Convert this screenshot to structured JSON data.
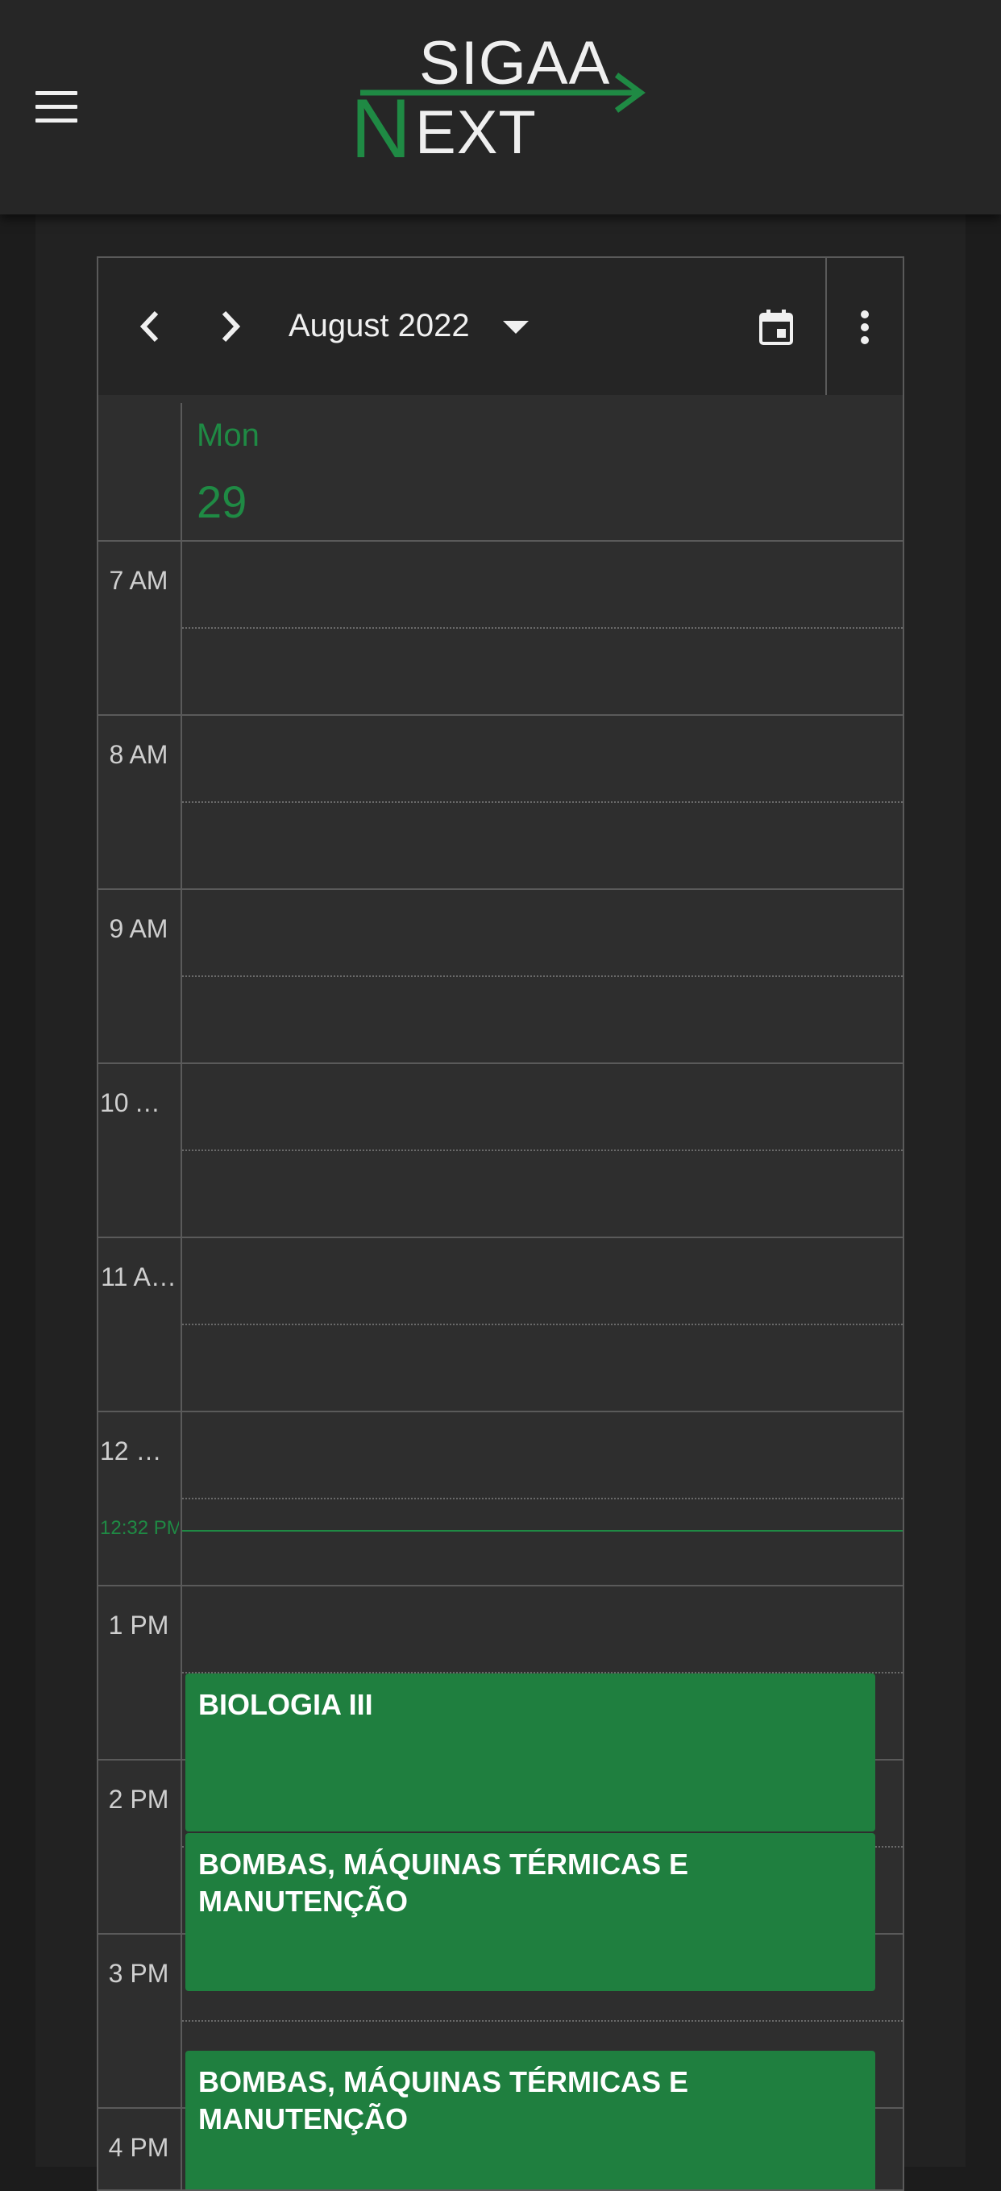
{
  "app": {
    "logo_top": "SIGAA",
    "logo_n": "N",
    "logo_bottom": "EXT",
    "accent_color": "#1f8a44"
  },
  "toolbar": {
    "prev_icon": "chevron-left-icon",
    "next_icon": "chevron-right-icon",
    "month": "August 2022",
    "today_icon": "calendar-today-icon",
    "more_icon": "more-vert-icon"
  },
  "day": {
    "name": "Mon",
    "number": "29"
  },
  "hours": [
    "7 AM",
    "8 AM",
    "9 AM",
    "10 A…",
    "11 A…",
    "12 P…",
    "1 PM",
    "2 PM",
    "3 PM",
    "4 PM"
  ],
  "now_label": "12:32 PM",
  "events": [
    {
      "title": "BIOLOGIA III",
      "start": "1:30 PM",
      "end": "2:25 PM"
    },
    {
      "title": "BOMBAS, MÁQUINAS TÉRMICAS E MANUTENÇÃO",
      "start": "2:25 PM",
      "end": "3:20 PM"
    },
    {
      "title": "BOMBAS, MÁQUINAS TÉRMICAS E MANUTENÇÃO",
      "start": "3:40 PM",
      "end": "4:35 PM"
    }
  ]
}
